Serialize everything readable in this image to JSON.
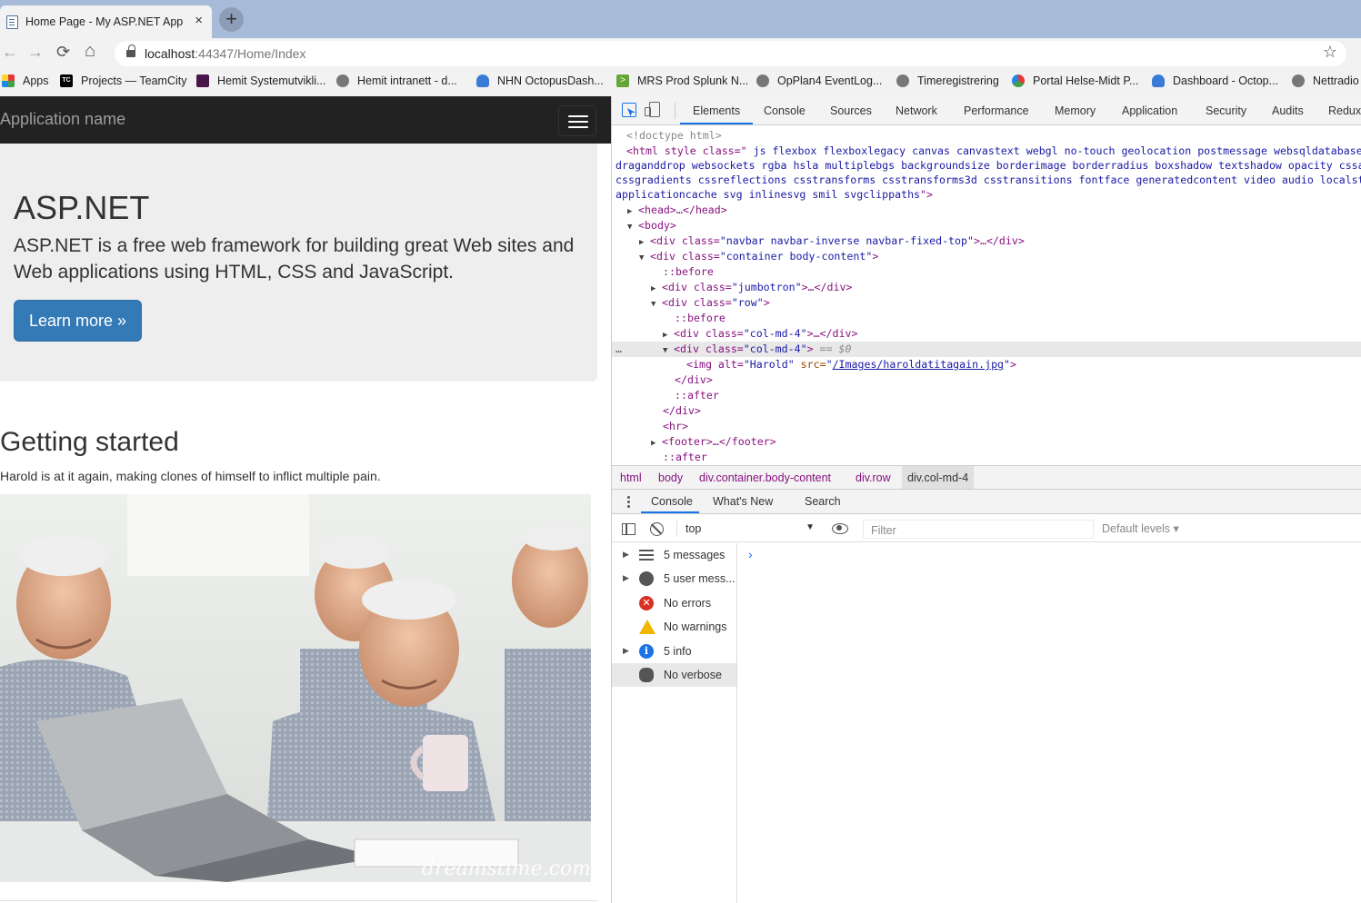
{
  "browser": {
    "tab_title": "Home Page - My ASP.NET Applic",
    "tab_close": "×",
    "new_tab": "+",
    "nav": {
      "back": "←",
      "forward": "→",
      "reload": "⟳",
      "home": "⌂"
    },
    "url_host": "localhost",
    "url_path": ":44347/Home/Index",
    "star": "☆",
    "bookmarks": [
      {
        "label": "Apps",
        "icon": "apps-icon"
      },
      {
        "label": "Projects — TeamCity",
        "icon": "teamcity-icon"
      },
      {
        "label": "Hemit Systemutvikli...",
        "icon": "slack-icon"
      },
      {
        "label": "Hemit intranett - d...",
        "icon": "globe-icon"
      },
      {
        "label": "NHN OctopusDash...",
        "icon": "octopus-icon"
      },
      {
        "label": "MRS Prod Splunk N...",
        "icon": "splunk-icon"
      },
      {
        "label": "OpPlan4 EventLog...",
        "icon": "globe-icon"
      },
      {
        "label": "Timeregistrering",
        "icon": "globe-icon"
      },
      {
        "label": "Portal Helse-Midt P...",
        "icon": "portal-icon"
      },
      {
        "label": "Dashboard - Octop...",
        "icon": "octopus-icon"
      },
      {
        "label": "Nettradio",
        "icon": "globe-icon"
      }
    ],
    "tc_text": "TC",
    "splunk_text": ">"
  },
  "page": {
    "brand": "Application name",
    "jumbo_title": "ASP.NET",
    "jumbo_text": "ASP.NET is a free web framework for building great Web sites and Web applications using HTML, CSS and JavaScript.",
    "learn_more": "Learn more »",
    "section_title": "Getting started",
    "section_text": "Harold is at it again, making clones of himself to inflict multiple pain.",
    "watermark": "dreamstime.com"
  },
  "devtools": {
    "tabs": [
      "Elements",
      "Console",
      "Sources",
      "Network",
      "Performance",
      "Memory",
      "Application",
      "Security",
      "Audits",
      "Redux"
    ],
    "breadcrumbs": [
      "html",
      "body",
      "div.container.body-content",
      "div.row",
      "div.col-md-4"
    ],
    "drawer_tabs": [
      "Console",
      "What's New",
      "Search"
    ],
    "context": "top",
    "filter_placeholder": "Filter",
    "levels": "Default levels ▾",
    "sidebar": [
      {
        "label": "5 messages",
        "icon": "list-icon",
        "expandable": true
      },
      {
        "label": "5 user mess...",
        "icon": "user-icon",
        "expandable": true
      },
      {
        "label": "No errors",
        "icon": "error-icon",
        "expandable": false
      },
      {
        "label": "No warnings",
        "icon": "warning-icon",
        "expandable": false
      },
      {
        "label": "5 info",
        "icon": "info-icon",
        "expandable": true
      },
      {
        "label": "No verbose",
        "icon": "bug-icon",
        "expandable": false
      }
    ],
    "prompt": "›",
    "dom": {
      "doctype": "<!doctype html>",
      "html_open": "<html style class=\"",
      "html_classes_1": " js flexbox flexboxlegacy canvas canvastext webgl no-touch geolocation postmessage websqldatabase",
      "html_classes_2": "draganddrop websockets rgba hsla multiplebgs backgroundsize borderimage borderradius boxshadow textshadow opacity cssanimations",
      "html_classes_3": "cssgradients cssreflections csstransforms csstransforms3d csstransitions fontface generatedcontent video audio localstorage",
      "html_classes_4": "applicationcache svg inlinesvg smil svgclippaths",
      "html_close": "\">",
      "head": "<head>…</head>",
      "body": "<body>",
      "navbar_open": "<div class=",
      "navbar_class": "\"navbar navbar-inverse navbar-fixed-top\"",
      "navbar_close": ">…</div>",
      "container_class": "\"container body-content\"",
      "before": "::before",
      "jumbotron_class": "\"jumbotron\"",
      "row_class": "\"row\"",
      "col_class": "\"col-md-4\"",
      "sel_marker": " == $0",
      "img_open": "<img alt=",
      "img_alt": "\"Harold\"",
      "img_src_attr": " src=",
      "img_src": "/Images/haroldatitagain.jpg",
      "div_end": "</div>",
      "after": "::after",
      "hr": "<hr>",
      "footer": "<footer>…</footer>",
      "gt": ">",
      "quote": "\"",
      "close_tag": ">…</div>",
      "ellipsis": "…"
    }
  }
}
